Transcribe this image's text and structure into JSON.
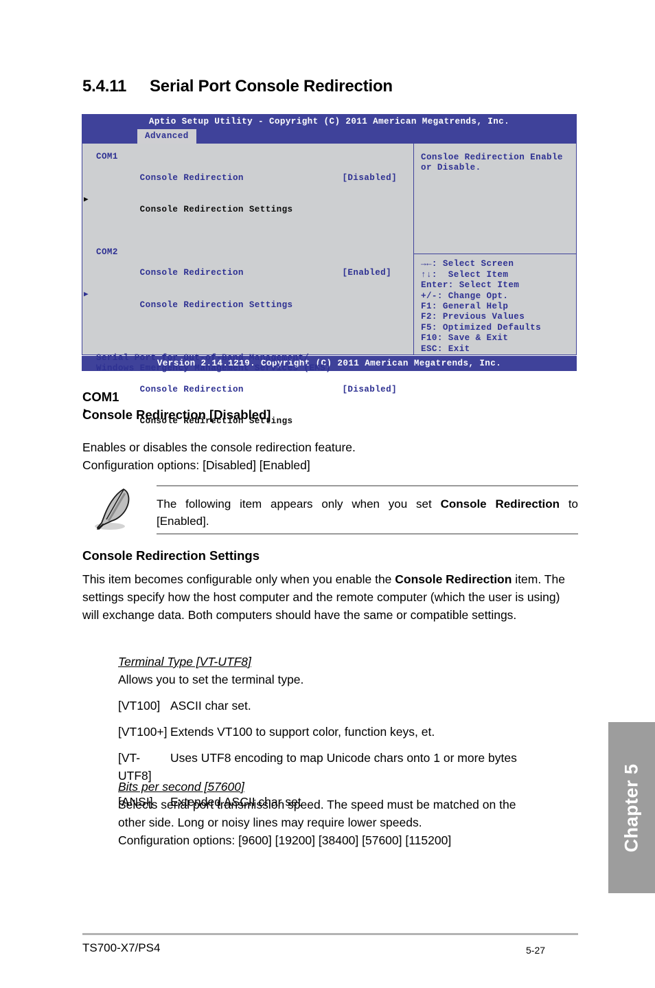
{
  "heading": {
    "number": "5.4.11",
    "title": "Serial Port Console Redirection"
  },
  "bios": {
    "titlebar": "Aptio Setup Utility - Copyright (C) 2011 American Megatrends, Inc.",
    "tab": "Advanced",
    "left": {
      "com1_label": "COM1",
      "com1_redirection_label": "Console Redirection",
      "com1_redirection_value": "[Disabled]",
      "com1_settings": "Console Redirection Settings",
      "com2_label": "COM2",
      "com2_redirection_label": "Console Redirection",
      "com2_redirection_value": "[Enabled]",
      "com2_settings": "Console Redirection Settings",
      "ems_line1": "Serial Port for Out-of-Band Management/",
      "ems_line2": "Windows Emergency Management Services (EMS)",
      "ems_redirection_label": "Console Redirection",
      "ems_redirection_value": "[Disabled]",
      "ems_settings": "Console Redirection Settings"
    },
    "help": {
      "line1": "Consloe Redirection Enable",
      "line2": "or Disable."
    },
    "keys": [
      "→←: Select Screen",
      "↑↓:  Select Item",
      "Enter: Select Item",
      "+/-: Change Opt.",
      "F1: General Help",
      "F2: Previous Values",
      "F5: Optimized Defaults",
      "F10: Save & Exit",
      "ESC: Exit"
    ],
    "footer": "Version 2.14.1219. Copyright (C) 2011 American Megatrends, Inc.",
    "colors": {
      "header_blue": "#3f429a",
      "panel_gray": "#cdcfd1",
      "text_blue": "#2e3192",
      "tab_gray": "#cfcfd2"
    }
  },
  "doc": {
    "com1_title": "COM1",
    "com1_item": "Console Redirection [Disabled]",
    "com1_desc_line1": "Enables or disables the console redirection feature.",
    "com1_desc_line2": "Configuration options: [Disabled] [Enabled]",
    "note": {
      "text_part1": "The following item appears only when you set ",
      "text_bold": "Console Redirection",
      "text_part2": " to [Enabled].",
      "icon": "quill-pen-icon"
    },
    "crs_heading": "Console Redirection Settings",
    "crs_para_part1": "This item becomes configurable only when you enable the ",
    "crs_para_bold": "Console Redirection",
    "crs_para_part2": " item. The settings specify how the host computer and the remote computer (which the user is using) will exchange data. Both computers should have the same or compatible settings.",
    "terminal": {
      "title": "Terminal Type [VT-UTF8]",
      "desc": "Allows you to set the terminal type.",
      "options": [
        {
          "key": "[VT100]",
          "desc": "ASCII char set."
        },
        {
          "key": "[VT100+]",
          "desc": "Extends VT100 to support color, function keys, et."
        },
        {
          "key": "[VT-UTF8]",
          "desc": "Uses UTF8 encoding to map Unicode chars onto 1 or more bytes"
        },
        {
          "key": "[ANSI]",
          "desc": "Extended ASCII char set"
        }
      ]
    },
    "bits": {
      "title": "Bits per second [57600]",
      "desc_line1": "Selects serial port transmission speed. The speed must be matched on the",
      "desc_line2": "other side. Long or noisy lines may require lower speeds.",
      "desc_line3": "Configuration options: [9600] [19200] [38400] [57600] [115200]"
    }
  },
  "chapter_tab": {
    "label": "Chapter 5",
    "color": "#9d9d9d"
  },
  "page_footer": {
    "model": "TS700-X7/PS4",
    "page_number": "5-27"
  }
}
